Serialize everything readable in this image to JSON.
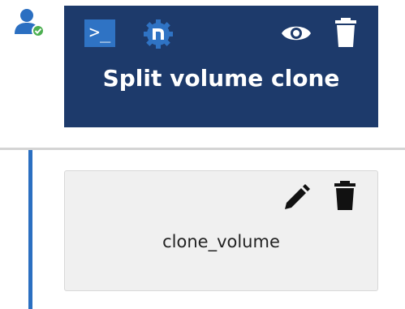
{
  "user": {
    "icon": "user-check-icon",
    "status_color": "#4caf50"
  },
  "header_card": {
    "title": "Split volume clone",
    "background_color": "#1d3a6b",
    "terminal_glyph": ">_",
    "icons": [
      "terminal-icon",
      "gear-icon",
      "eye-icon",
      "trash-icon"
    ]
  },
  "step_card": {
    "label": "clone_volume",
    "icons": [
      "pencil-icon",
      "trash-icon"
    ]
  },
  "colors": {
    "accent": "#2b6fc1",
    "card_bg": "#f0f0f0"
  }
}
